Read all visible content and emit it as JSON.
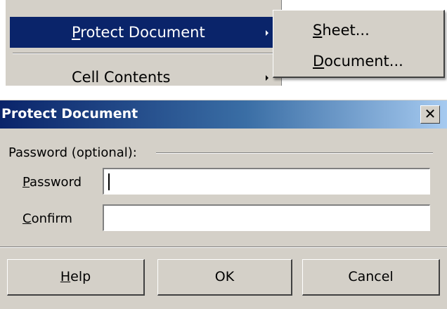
{
  "menu": {
    "items": [
      {
        "label_mnemonic": "P",
        "label_rest": "rotect Document",
        "highlighted": true
      },
      {
        "label_mnemonic": "",
        "label_rest": "Cell Contents",
        "highlighted": false
      }
    ],
    "submenu": [
      {
        "label_mnemonic": "S",
        "label_rest": "heet..."
      },
      {
        "label_mnemonic": "D",
        "label_rest": "ocument..."
      }
    ]
  },
  "dialog": {
    "title": "Protect Document",
    "close_glyph": "✕",
    "group_label": "Password (optional):",
    "password_label_mnemonic": "P",
    "password_label_rest": "assword",
    "confirm_label_mnemonic": "C",
    "confirm_label_rest": "onfirm",
    "password_value": "",
    "confirm_value": "",
    "buttons": {
      "help_mnemonic": "H",
      "help_rest": "elp",
      "ok": "OK",
      "cancel": "Cancel"
    }
  },
  "colors": {
    "menu_highlight": "#0a246a",
    "face": "#d4d0c8",
    "title_gradient_start": "#0a246a",
    "title_gradient_end": "#a6caf0"
  }
}
